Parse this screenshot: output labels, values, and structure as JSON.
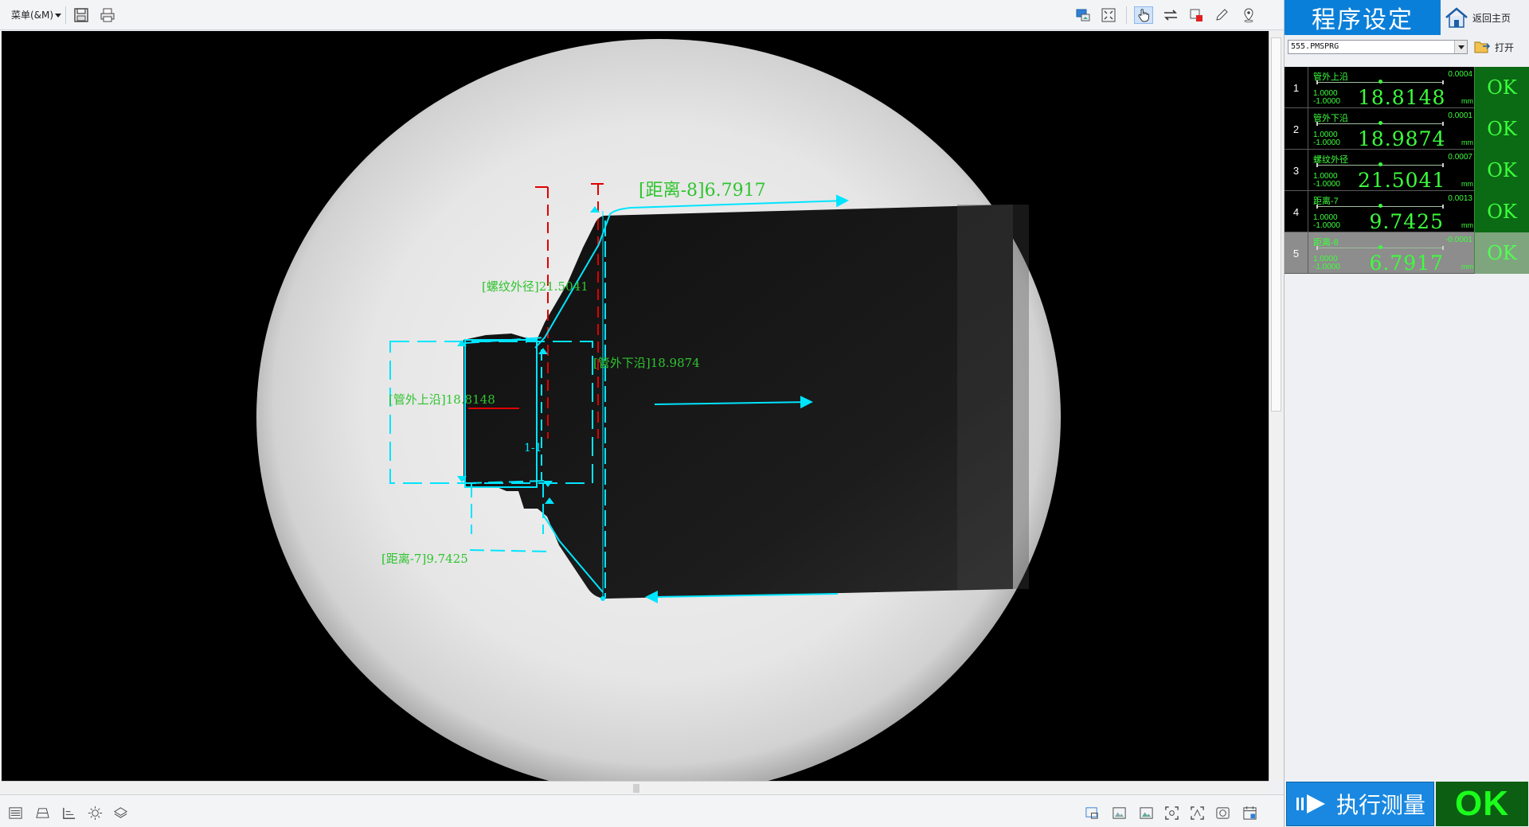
{
  "toolbar": {
    "menu_label": "菜单(&M)",
    "icons": [
      "save-icon",
      "print-icon",
      "image-source-icon",
      "fit-screen-icon",
      "hand-pointer-icon",
      "swap-arrow-icon",
      "crop-icon",
      "pencil-icon",
      "location-pin-icon"
    ]
  },
  "viewport": {
    "annotations": {
      "distance_8": "[距离-8]6.7917",
      "thread_od": "[螺纹外径]21.5041",
      "outer_lower": "[管外下沿]18.9874",
      "outer_upper": "[管外上沿]18.8148",
      "distance_7": "[距离-7]9.7425",
      "center_label": "1-1"
    }
  },
  "right_panel": {
    "title": "程序设定",
    "home_label": "返回主页",
    "file_name": "555.PMSPRG",
    "open_label": "打开",
    "results": [
      {
        "index": "1",
        "name": "管外上沿",
        "deviation": "0.0004",
        "upper": "1.0000",
        "lower": "-1.0000",
        "value": "18.8148",
        "unit": "mm",
        "status": "OK",
        "position": 0.5002
      },
      {
        "index": "2",
        "name": "管外下沿",
        "deviation": "0.0001",
        "upper": "1.0000",
        "lower": "-1.0000",
        "value": "18.9874",
        "unit": "mm",
        "status": "OK",
        "position": 0.50005
      },
      {
        "index": "3",
        "name": "螺纹外径",
        "deviation": "0.0007",
        "upper": "1.0000",
        "lower": "-1.0000",
        "value": "21.5041",
        "unit": "mm",
        "status": "OK",
        "position": 0.50035
      },
      {
        "index": "4",
        "name": "距离-7",
        "deviation": "0.0013",
        "upper": "1.0000",
        "lower": "-1.0000",
        "value": "9.7425",
        "unit": "mm",
        "status": "OK",
        "position": 0.50065
      },
      {
        "index": "5",
        "name": "距离-8",
        "deviation": "-0.0001",
        "upper": "1.0000",
        "lower": "-1.0000",
        "value": "6.7917",
        "unit": "mm",
        "status": "OK",
        "position": 0.49995
      }
    ],
    "execute_label": "执行测量",
    "overall_status": "OK"
  },
  "colors": {
    "title_blue": "#0a7fd9",
    "result_green": "#3cff3c",
    "ok_bg": "#0b5e12",
    "overlay_cyan": "#00e5ff",
    "overlay_red": "#e00000",
    "label_green": "#2fc42f"
  }
}
